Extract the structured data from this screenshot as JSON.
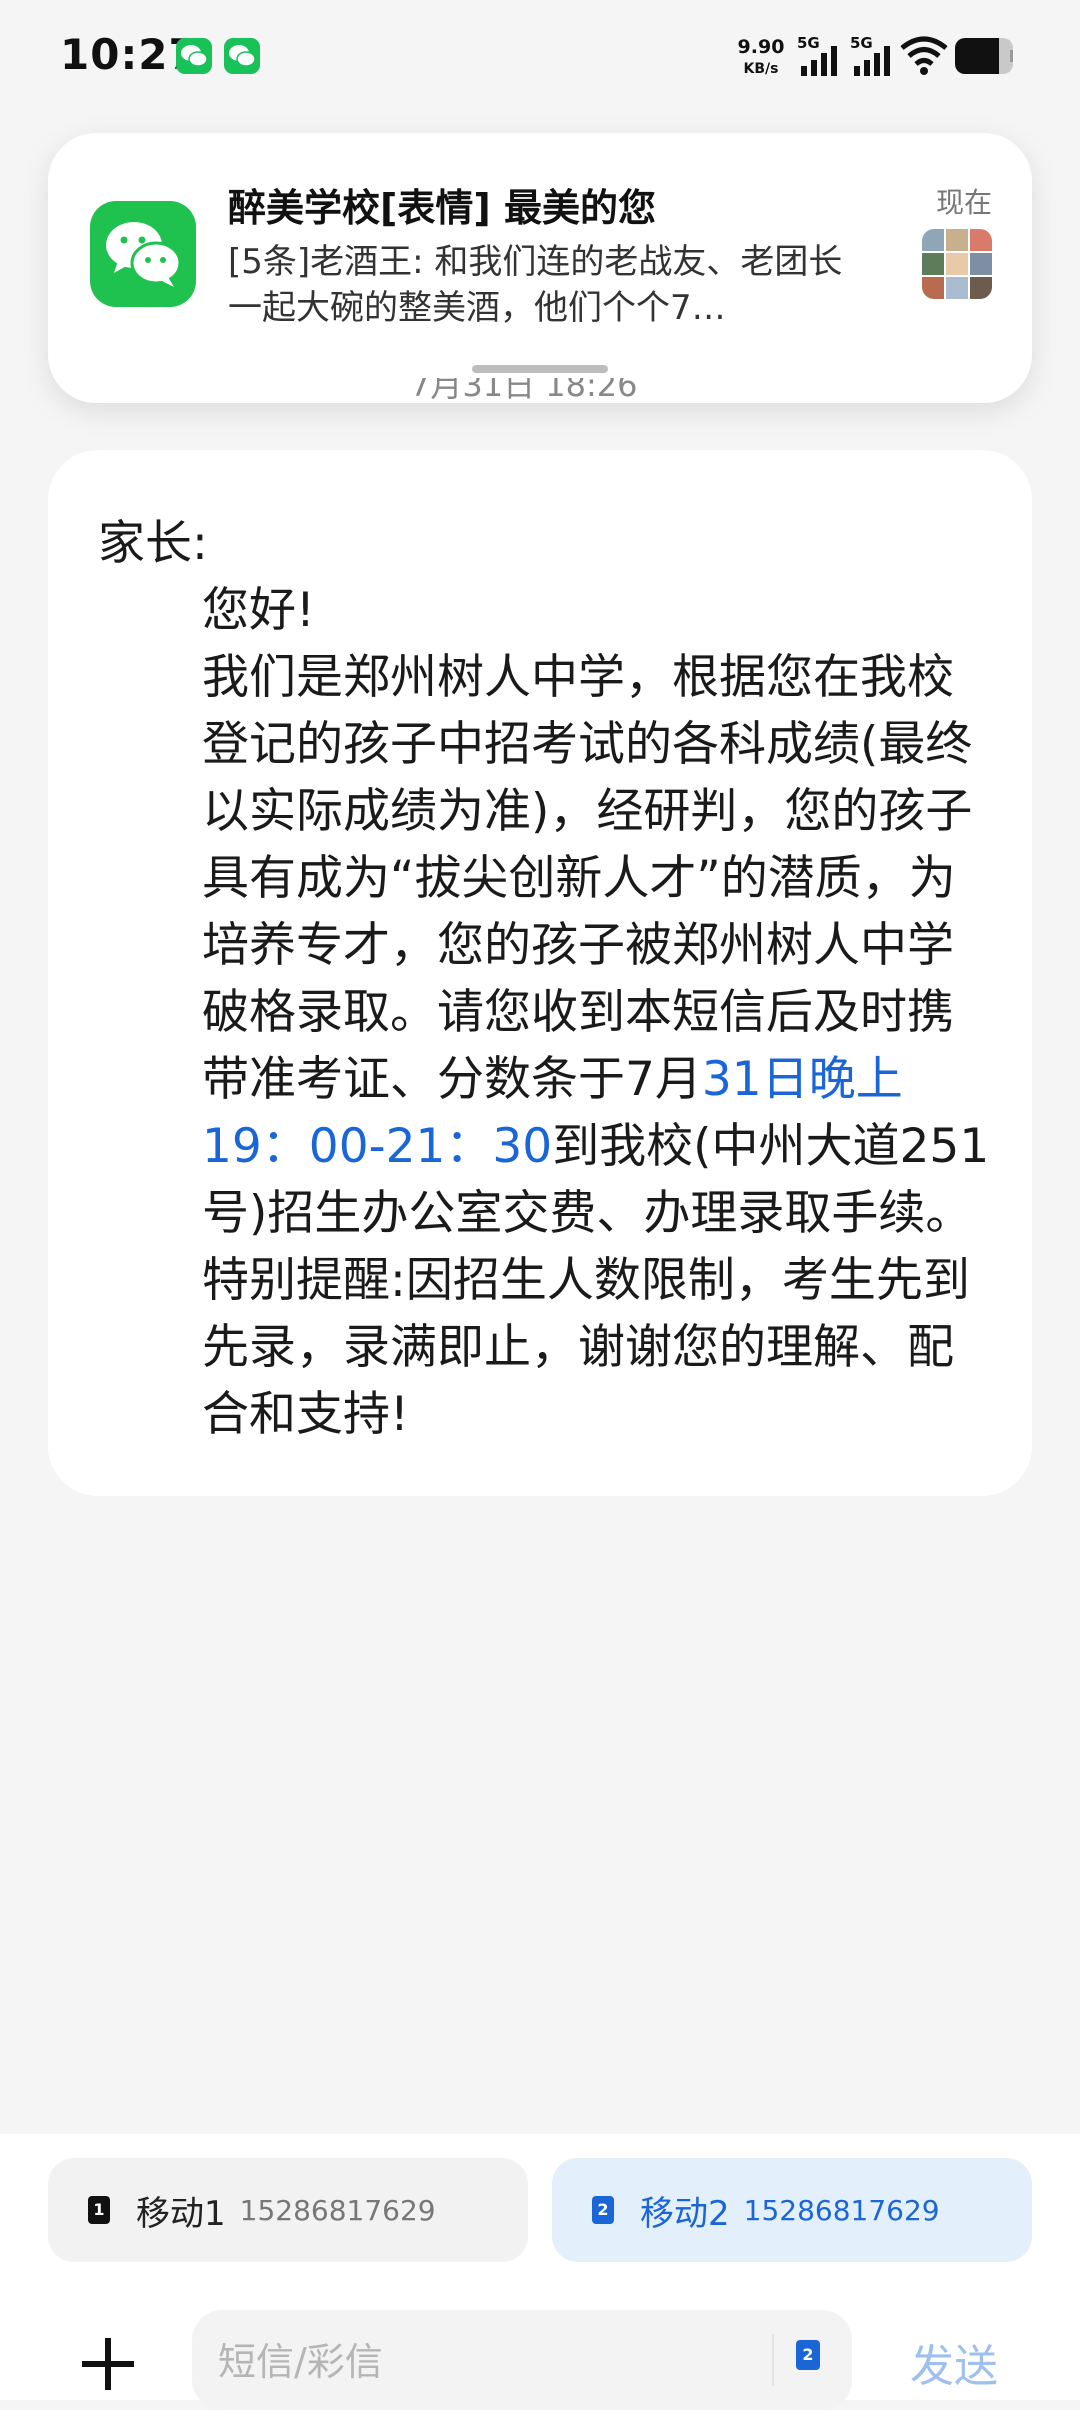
{
  "status_bar": {
    "time": "10:27",
    "speed_value": "9.90",
    "speed_unit": "KB/s",
    "network_1": "5G",
    "network_2": "5G"
  },
  "notification": {
    "app_icon": "wechat-icon",
    "title": "醉美学校[表情]  最美的您",
    "time": "现在",
    "body": "[5条]老酒王: 和我们连的老战友、老团长一起大碗的整美酒，他们个个7…"
  },
  "message_time_partial": "7月31日 18:26",
  "message": {
    "greeting": "家长:",
    "hello": "您好!",
    "paragraph1_start": "我们是郑州树人中学，根据您在我校登记的孩子中招考试的各科成绩(最终以实际成绩为准)，经研判，您的孩子具有成为“拔尖创新人才”的潜质，为培养专才，您的孩子被郑州树人中学破格录取。请您收到本短信后及时携带准考证、分数条于7月",
    "paragraph1_link": "31日晚上19：00-21：30",
    "paragraph1_end": "到我校(中州大道251号)招生办公室交费、办理录取手续。",
    "paragraph2": "特别提醒:因招生人数限制，考生先到先录，录满即止，谢谢您的理解、配合和支持!"
  },
  "sim": {
    "sim1": {
      "badge": "1",
      "name": "移动1",
      "number": "15286817629"
    },
    "sim2": {
      "badge": "2",
      "name": "移动2",
      "number": "15286817629"
    }
  },
  "compose": {
    "placeholder": "短信/彩信",
    "sim_badge": "2",
    "send_label": "发送"
  },
  "colors": {
    "accent": "#1a66d6",
    "wechat_green": "#1fc14f",
    "background": "#f5f5f5"
  },
  "battery_level": 0.75
}
